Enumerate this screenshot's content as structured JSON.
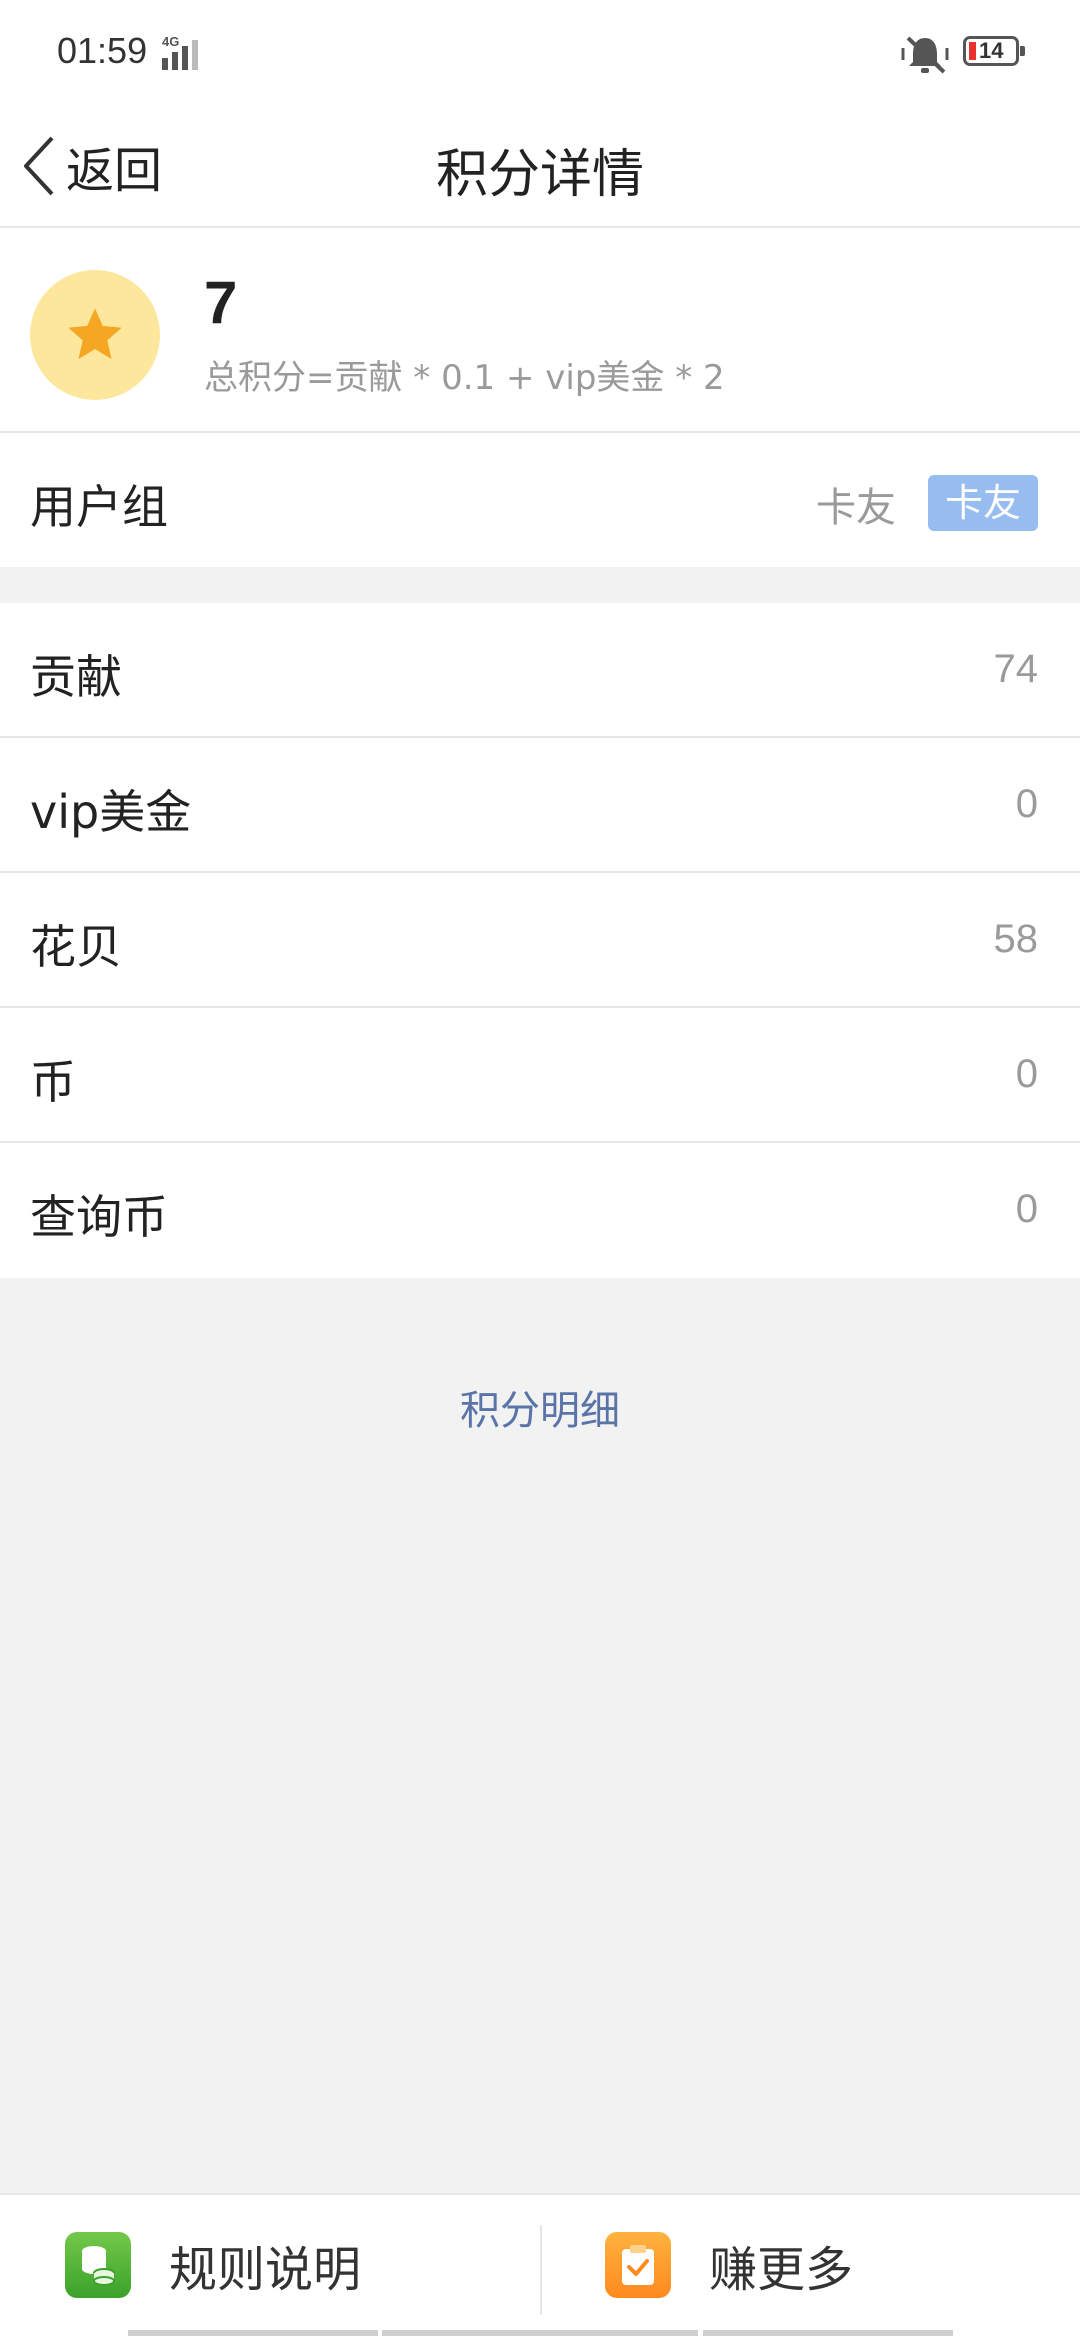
{
  "status": {
    "time": "01:59",
    "network": "4G",
    "battery": "14"
  },
  "nav": {
    "back_label": "返回",
    "title": "积分详情"
  },
  "summary": {
    "score": "7",
    "formula": "总积分=贡献 * 0.1 + vip美金 * 2"
  },
  "usergroup": {
    "label": "用户组",
    "value": "卡友",
    "badge": "卡友"
  },
  "stats": [
    {
      "label": "贡献",
      "value": "74"
    },
    {
      "label": "vip美金",
      "value": "0"
    },
    {
      "label": "花贝",
      "value": "58"
    },
    {
      "label": "币",
      "value": "0"
    },
    {
      "label": "查询币",
      "value": "0"
    }
  ],
  "detail_link": "积分明细",
  "bottom": {
    "rules_label": "规则说明",
    "earn_label": "赚更多"
  },
  "colors": {
    "accent": "#5a74a8",
    "badge": "#97bdf0",
    "avatar_bg": "#fde79d",
    "star": "#f5a623"
  }
}
